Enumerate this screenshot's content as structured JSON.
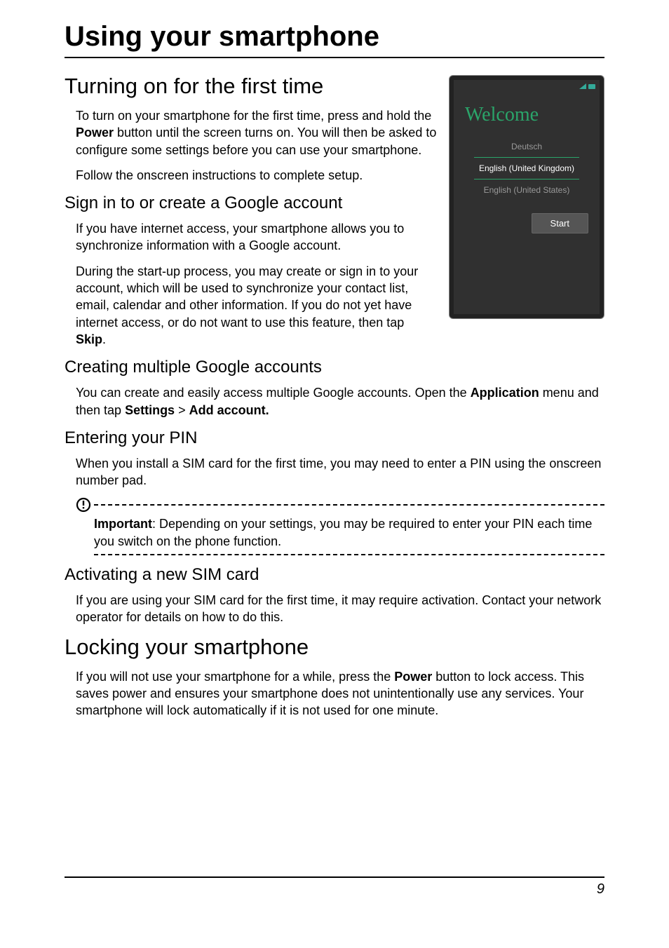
{
  "chapter": {
    "title": "Using your smartphone"
  },
  "section1": {
    "title": "Turning on for the first time",
    "para1_a": "To turn on your smartphone for the first time, press and hold the ",
    "para1_bold": "Power",
    "para1_b": " button until the screen turns on. You will then be asked to configure some settings before you can use your smartphone.",
    "para2": "Follow the onscreen instructions to complete setup."
  },
  "welcome_screen": {
    "title": "Welcome",
    "lang_prev": "Deutsch",
    "lang_selected": "English (United Kingdom)",
    "lang_next": "English (United States)",
    "start_label": "Start"
  },
  "signin": {
    "title": "Sign in to or create a Google account",
    "para1": "If you have internet access, your smartphone allows you to synchronize information with a Google account.",
    "para2_a": "During the start-up process, you may create or sign in to your account, which will be used to synchronize your contact list, email, calendar and other information. If you do not yet have internet access, or do not want to use this feature, then tap ",
    "para2_bold": "Skip",
    "para2_b": "."
  },
  "multiple": {
    "title": "Creating multiple Google accounts",
    "para_a": "You can create and easily access multiple Google accounts. Open the ",
    "bold1": "Application",
    "para_b": " menu and then tap ",
    "bold2": "Settings",
    "para_c": " > ",
    "bold3": "Add account."
  },
  "pin": {
    "title": "Entering your PIN",
    "para": "When you install a SIM card for the first time, you may need to enter a PIN using the onscreen number pad.",
    "important_bold": "Important",
    "important_text": ": Depending on your settings, you may be required to enter your PIN each time you switch on the phone function."
  },
  "sim": {
    "title": "Activating a new SIM card",
    "para": "If you are using your SIM card for the first time, it may require activation. Contact your network operator for details on how to do this."
  },
  "locking": {
    "title": "Locking your smartphone",
    "para_a": "If you will not use your smartphone for a while, press the ",
    "para_bold": "Power",
    "para_b": " button to lock access. This saves power and ensures your smartphone does not unintentionally use any services. Your smartphone will lock automatically if it is not used for one minute."
  },
  "page_number": "9"
}
